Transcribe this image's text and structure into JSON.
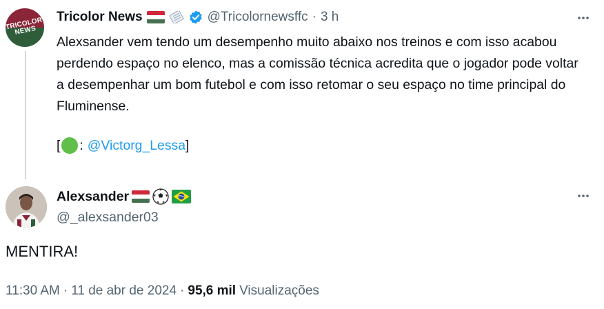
{
  "tweet1": {
    "avatar_logo_lines": [
      "TRICOLOR",
      "NEWS"
    ],
    "display_name": "Tricolor News",
    "handle": "@Tricolornewsffc",
    "separator": "·",
    "time_ago": "3 h",
    "body": "Alexsander vem tendo um desempenho muito abaixo nos treinos e com isso acabou perdendo espaço no elenco, mas a comissão técnica acredita que o jogador pode voltar a desempenhar um bom futebol e com isso retomar o seu espaço no time principal do Fluminense.",
    "credit_open": "[",
    "credit_colon": ":",
    "credit_mention": "@Victorg_Lessa",
    "credit_close": "]",
    "icons": [
      "hungary-flag-icon",
      "newspaper-icon",
      "verified-badge-icon",
      "more-icon"
    ]
  },
  "tweet2": {
    "display_name": "Alexsander",
    "handle": "@_alexsander03",
    "text": "MENTIRA!",
    "icons": [
      "hungary-flag-icon",
      "soccer-ball-icon",
      "brazil-flag-icon",
      "more-icon"
    ]
  },
  "meta": {
    "time": "11:30 AM",
    "dot1": "·",
    "date": "11 de abr de 2024",
    "dot2": "·",
    "views_count": "95,6 mil",
    "views_label": "Visualizações"
  },
  "colors": {
    "link": "#1d9bf0",
    "muted": "#536471",
    "text": "#0f1419",
    "verified": "#1d9bf0",
    "thread_line": "#cfd9de"
  }
}
